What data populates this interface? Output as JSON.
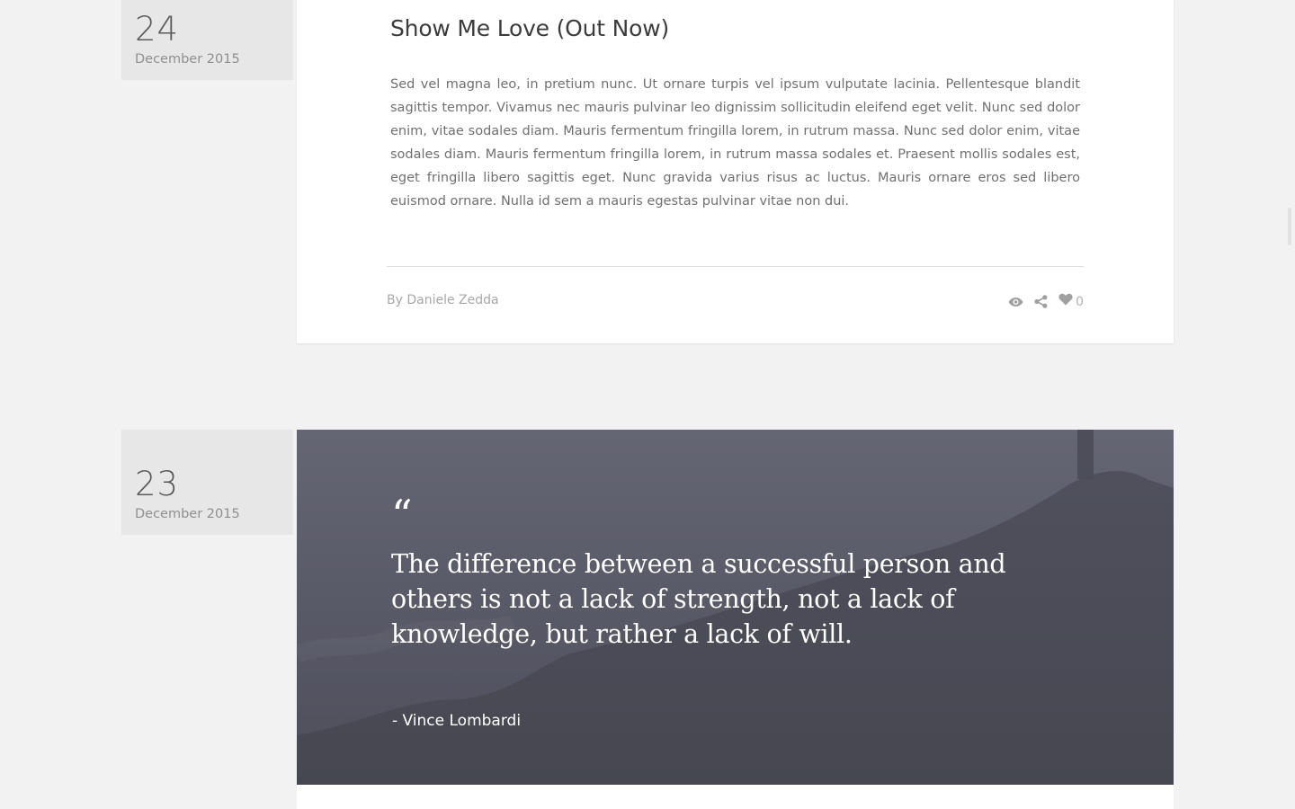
{
  "posts": [
    {
      "date": {
        "day": "24",
        "month": "December 2015"
      },
      "title": "Show Me Love (Out Now)",
      "body": "Sed vel magna leo, in pretium nunc. Ut ornare turpis vel ipsum vulputate lacinia. Pellentesque blandit sagittis tempor. Vivamus nec mauris pulvinar leo dignissim sollicitudin eleifend eget velit. Nunc sed dolor enim, vitae sodales diam. Mauris fermentum fringilla lorem, in rutrum massa. Nunc sed dolor enim, vitae sodales diam. Mauris fermentum fringilla lorem, in rutrum massa sodales et. Praesent mollis sodales est, eget fringilla libero sagittis eget. Nunc gravida varius risus ac luctus. Mauris ornare eros sed libero euismod ornare. Nulla id sem a mauris egestas pulvinar vitae non dui.",
      "author_prefix": "By",
      "author": "Daniele Zedda",
      "actions": {
        "view_icon": "eye-icon",
        "share_icon": "share-icon",
        "like_icon": "heart-icon",
        "like_count": "0"
      }
    },
    {
      "date": {
        "day": "23",
        "month": "December 2015"
      },
      "quote_mark": "“",
      "quote": "The difference between a successful person and others is not a lack of strength, not a lack of knowledge, but rather a lack of will.",
      "quote_author": "- Vince Lombardi"
    }
  ],
  "colors": {
    "background": "#f2f2f2",
    "date_box": "#e7e7e7",
    "quote_overlay": "#5a5b68"
  }
}
